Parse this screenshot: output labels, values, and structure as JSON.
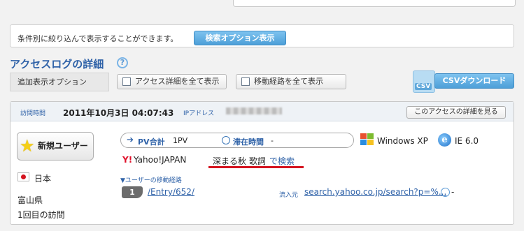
{
  "filter": {
    "description": "条件別に絞り込んで表示することができます。",
    "search_options_button": "検索オプション表示"
  },
  "section": {
    "title": "アクセスログの詳細",
    "help_icon_glyph": "?"
  },
  "options": {
    "label": "追加表示オプション",
    "show_all_access_details": "アクセス詳細を全て表示",
    "show_all_routes": "移動経路を全て表示"
  },
  "csv": {
    "icon_label": "CSV",
    "download_button": "CSVダウンロード"
  },
  "entry": {
    "visit_time_label": "訪問時間",
    "visit_datetime": "2011年10月3日 04:07:43",
    "ip_label": "IPアドレス",
    "detail_button": "このアクセスの詳細を見る",
    "user_type": "新規ユーザー",
    "pv_label": "PV合計",
    "pv_value": "1PV",
    "stay_label": "滞在時間",
    "stay_value": "-",
    "os": "Windows XP",
    "browser": "IE 6.0",
    "search_engine_icon": "Y!",
    "search_engine": "Yahoo!JAPAN",
    "search_keyword": "深まる秋  歌詞",
    "search_suffix": "で検索",
    "country": "日本",
    "route_label": "▼ユーザーの移動経路",
    "route_step": "1",
    "route_page": "/Entry/652/",
    "referrer_label": "流入元",
    "referrer_url": "search.yahoo.co.jp/search?p=%...",
    "route_time": "-",
    "prefecture": "富山県",
    "visit_count": "1回目の訪問"
  },
  "colors": {
    "accent_blue": "#2f62a8",
    "button_blue": "#5aa8df",
    "highlight_red": "#d4141f",
    "background": "#f2f2f2"
  }
}
